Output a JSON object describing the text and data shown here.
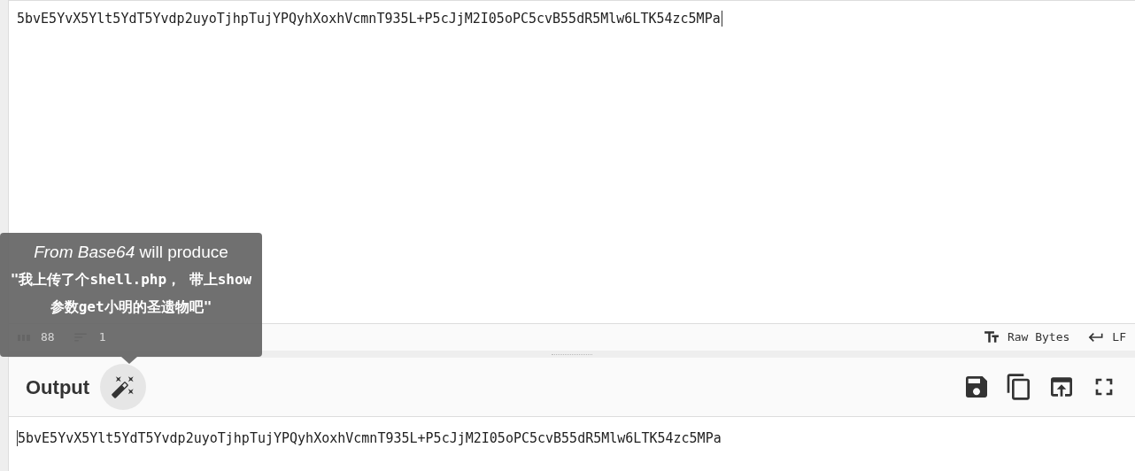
{
  "input": {
    "value": "5bvE5YvX5Ylt5YdT5Yvdp2uyoTjhpTujYPQyhXoxhVcmnT935L+P5cJjM2I05oPC5cvB55dR5Mlw6LTK54zc5MPa"
  },
  "input_status": {
    "length": "88",
    "lines": "1",
    "encoding": "Raw Bytes",
    "eol": "LF"
  },
  "tooltip": {
    "intro": "*From Base64* will produce",
    "result": "\"我上传了个shell.php， 带上show参数get小明的圣遗物吧\""
  },
  "output": {
    "title": "Output",
    "value": "5bvE5YvX5Ylt5YdT5Yvdp2uyoTjhpTujYPQyhXoxhVcmnT935L+P5cJjM2I05oPC5cvB55dR5Mlw6LTK54zc5MPa"
  }
}
